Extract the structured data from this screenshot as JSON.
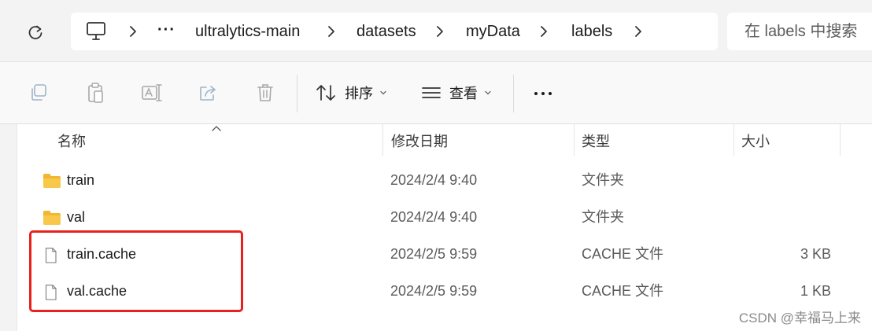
{
  "address": {
    "crumbs": [
      "ultralytics-main",
      "datasets",
      "myData",
      "labels"
    ],
    "overflow": "···",
    "search_placeholder": "在 labels 中搜索"
  },
  "toolbar": {
    "sort_label": "排序",
    "view_label": "查看"
  },
  "columns": {
    "name": "名称",
    "date": "修改日期",
    "type": "类型",
    "size": "大小"
  },
  "rows": [
    {
      "name": "train",
      "date": "2024/2/4 9:40",
      "type": "文件夹",
      "size": "",
      "icon": "folder-icon"
    },
    {
      "name": "val",
      "date": "2024/2/4 9:40",
      "type": "文件夹",
      "size": "",
      "icon": "folder-icon"
    },
    {
      "name": "train.cache",
      "date": "2024/2/5 9:59",
      "type": "CACHE 文件",
      "size": "3 KB",
      "icon": "file-icon"
    },
    {
      "name": "val.cache",
      "date": "2024/2/5 9:59",
      "type": "CACHE 文件",
      "size": "1 KB",
      "icon": "file-icon"
    }
  ],
  "watermark": "CSDN @幸福马上来",
  "colors": {
    "highlight": "#e8211c",
    "folder": "#f8c84a"
  }
}
